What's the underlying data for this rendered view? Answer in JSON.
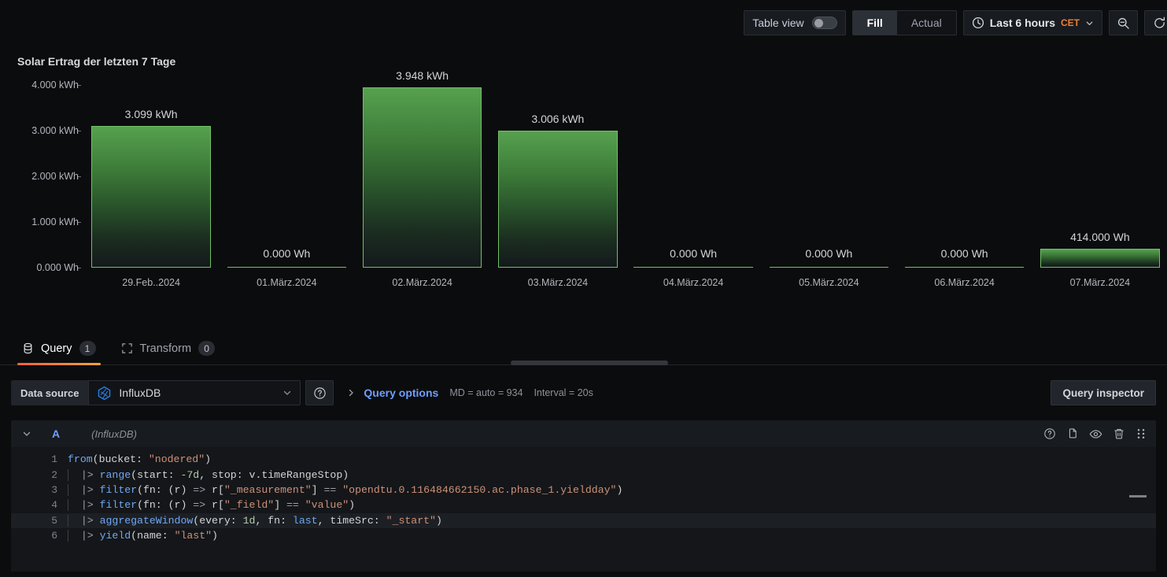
{
  "toolbar": {
    "table_view_label": "Table view",
    "table_view_on": false,
    "fill_label": "Fill",
    "actual_label": "Actual",
    "active_segment": "Fill",
    "time_range": "Last 6 hours",
    "timezone": "CET",
    "icons": {
      "clock": "clock-icon",
      "chevron": "chevron-down-icon",
      "zoom_out": "zoom-out-icon",
      "refresh": "refresh-icon"
    }
  },
  "panel": {
    "title": "Solar Ertrag der letzten 7 Tage"
  },
  "chart_data": {
    "type": "bar",
    "title": "Solar Ertrag der letzten 7 Tage",
    "xlabel": "",
    "ylabel": "",
    "ylim": [
      0,
      4000
    ],
    "grid": false,
    "legend": "none",
    "unit": "Wh",
    "y_ticks": [
      {
        "value": 0,
        "label": "0.000 Wh"
      },
      {
        "value": 1000,
        "label": "1.000 kWh"
      },
      {
        "value": 2000,
        "label": "2.000 kWh"
      },
      {
        "value": 3000,
        "label": "3.000 kWh"
      },
      {
        "value": 4000,
        "label": "4.000 kWh"
      }
    ],
    "categories": [
      "29.Feb..2024",
      "01.März.2024",
      "02.März.2024",
      "03.März.2024",
      "04.März.2024",
      "05.März.2024",
      "06.März.2024",
      "07.März.2024"
    ],
    "values": [
      3099,
      0,
      3948,
      3006,
      0,
      0,
      0,
      414
    ],
    "value_labels": [
      "3.099 kWh",
      "0.000 Wh",
      "3.948 kWh",
      "3.006 kWh",
      "0.000 Wh",
      "0.000 Wh",
      "0.000 Wh",
      "414.000 Wh"
    ],
    "bar_color": "#73bf69",
    "bar_fill_top": "#56a14f"
  },
  "tabs": [
    {
      "label": "Query",
      "count": "1",
      "icon": "database-icon",
      "active": true
    },
    {
      "label": "Transform",
      "count": "0",
      "icon": "transform-icon",
      "active": false
    }
  ],
  "query_bar": {
    "data_source_label": "Data source",
    "data_source_value": "InfluxDB",
    "data_source_icon": "influxdb-icon",
    "help_icon": "help-circle-icon",
    "expand_icon": "chevron-right-icon",
    "query_options_label": "Query options",
    "max_data_points": "MD = auto = 934",
    "interval": "Interval = 20s",
    "query_inspector_label": "Query inspector"
  },
  "query_row": {
    "ref_id": "A",
    "datasource_note": "(InfluxDB)",
    "collapse_icon": "chevron-down-icon",
    "actions": [
      {
        "name": "help-circle-icon",
        "label": "Help"
      },
      {
        "name": "copy-icon",
        "label": "Duplicate query"
      },
      {
        "name": "eye-icon",
        "label": "Disable query"
      },
      {
        "name": "trash-icon",
        "label": "Remove query"
      },
      {
        "name": "drag-handle-icon",
        "label": "Drag to reorder"
      }
    ]
  },
  "code": {
    "lines": [
      {
        "n": "1",
        "text": "from(bucket: \"nodered\")"
      },
      {
        "n": "2",
        "text": "  |> range(start: -7d, stop: v.timeRangeStop)"
      },
      {
        "n": "3",
        "text": "  |> filter(fn: (r) => r[\"_measurement\"] == \"opendtu.0.116484662150.ac.phase_1.yieldday\")"
      },
      {
        "n": "4",
        "text": "  |> filter(fn: (r) => r[\"_field\"] == \"value\")"
      },
      {
        "n": "5",
        "text": "  |> aggregateWindow(every: 1d, fn: last, timeSrc: \"_start\")"
      },
      {
        "n": "6",
        "text": "  |> yield(name: \"last\")"
      }
    ],
    "active_line": 5
  }
}
